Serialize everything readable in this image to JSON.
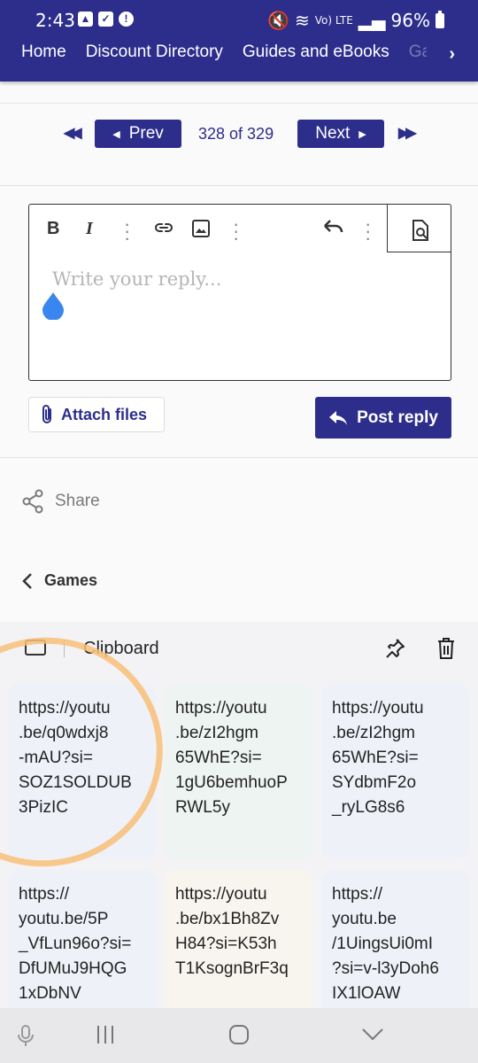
{
  "status": {
    "time": "2:43",
    "battery": "96%",
    "net_label": "Vo) LTE"
  },
  "nav": {
    "items": [
      "Home",
      "Discount Directory",
      "Guides and eBooks",
      "Ga"
    ]
  },
  "pager": {
    "prev": "Prev",
    "next": "Next",
    "count": "328 of 329"
  },
  "editor": {
    "placeholder": "Write your reply..."
  },
  "actions": {
    "attach": "Attach files",
    "post": "Post reply"
  },
  "share": {
    "label": "Share"
  },
  "breadcrumb": {
    "label": "Games"
  },
  "clipboard": {
    "title": "Clipboard",
    "items": [
      "https://youtu\n.be/q0wdxj8\n-mAU?si=\nSOZ1SOLDUB\n3PizIC",
      "https://youtu\n.be/zI2hgm\n65WhE?si=\n1gU6bemhuoP\nRWL5y",
      "https://youtu\n.be/zI2hgm\n65WhE?si=\nSYdbmF2o\n_ryLG8s6",
      "https://\nyoutu.be/5P\n_VfLun96o?si=\nDfUMuJ9HQG\n1xDbNV",
      "https://youtu\n.be/bx1Bh8Zv\nH84?si=K53h\nT1KsognBrF3q",
      "https://\nyoutu.be\n/1UingsUi0mI\n?si=v-l3yDoh6\nIX1lOAW"
    ]
  },
  "colors": {
    "brand": "#2d2e8c",
    "highlight": "#f8be78",
    "drop": "#3a86f0"
  }
}
